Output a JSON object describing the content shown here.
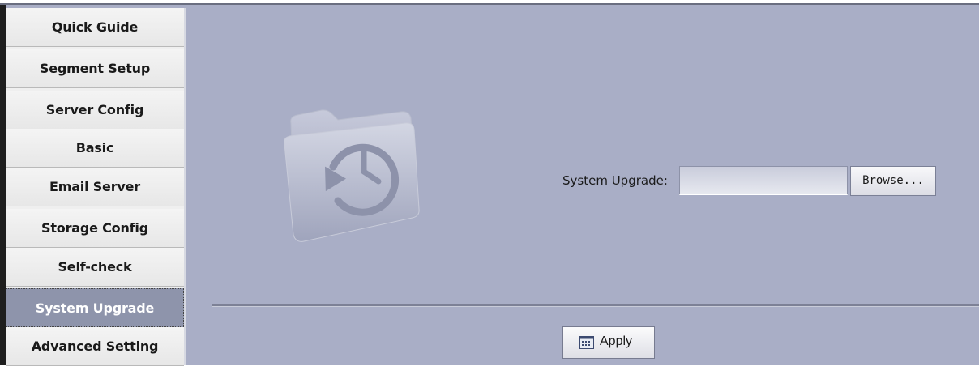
{
  "sidebar": {
    "items": [
      {
        "label": "Quick Guide",
        "active": false
      },
      {
        "label": "Segment Setup",
        "active": false
      },
      {
        "label": "Server Config",
        "active": false
      },
      {
        "label": "Basic",
        "active": false
      },
      {
        "label": "Email Server",
        "active": false
      },
      {
        "label": "Storage Config",
        "active": false
      },
      {
        "label": "Self-check",
        "active": false
      },
      {
        "label": "System Upgrade",
        "active": true
      },
      {
        "label": "Advanced Setting",
        "active": false
      }
    ]
  },
  "main": {
    "icon": "folder-time-machine-icon",
    "upgrade_label": "System Upgrade:",
    "upgrade_value": "",
    "browse_label": "Browse...",
    "apply_label": "Apply",
    "apply_icon": "keyboard-icon"
  },
  "colors": {
    "background": "#a9aec6",
    "active_item": "#8e94ab",
    "sidebar": "#efefef"
  }
}
